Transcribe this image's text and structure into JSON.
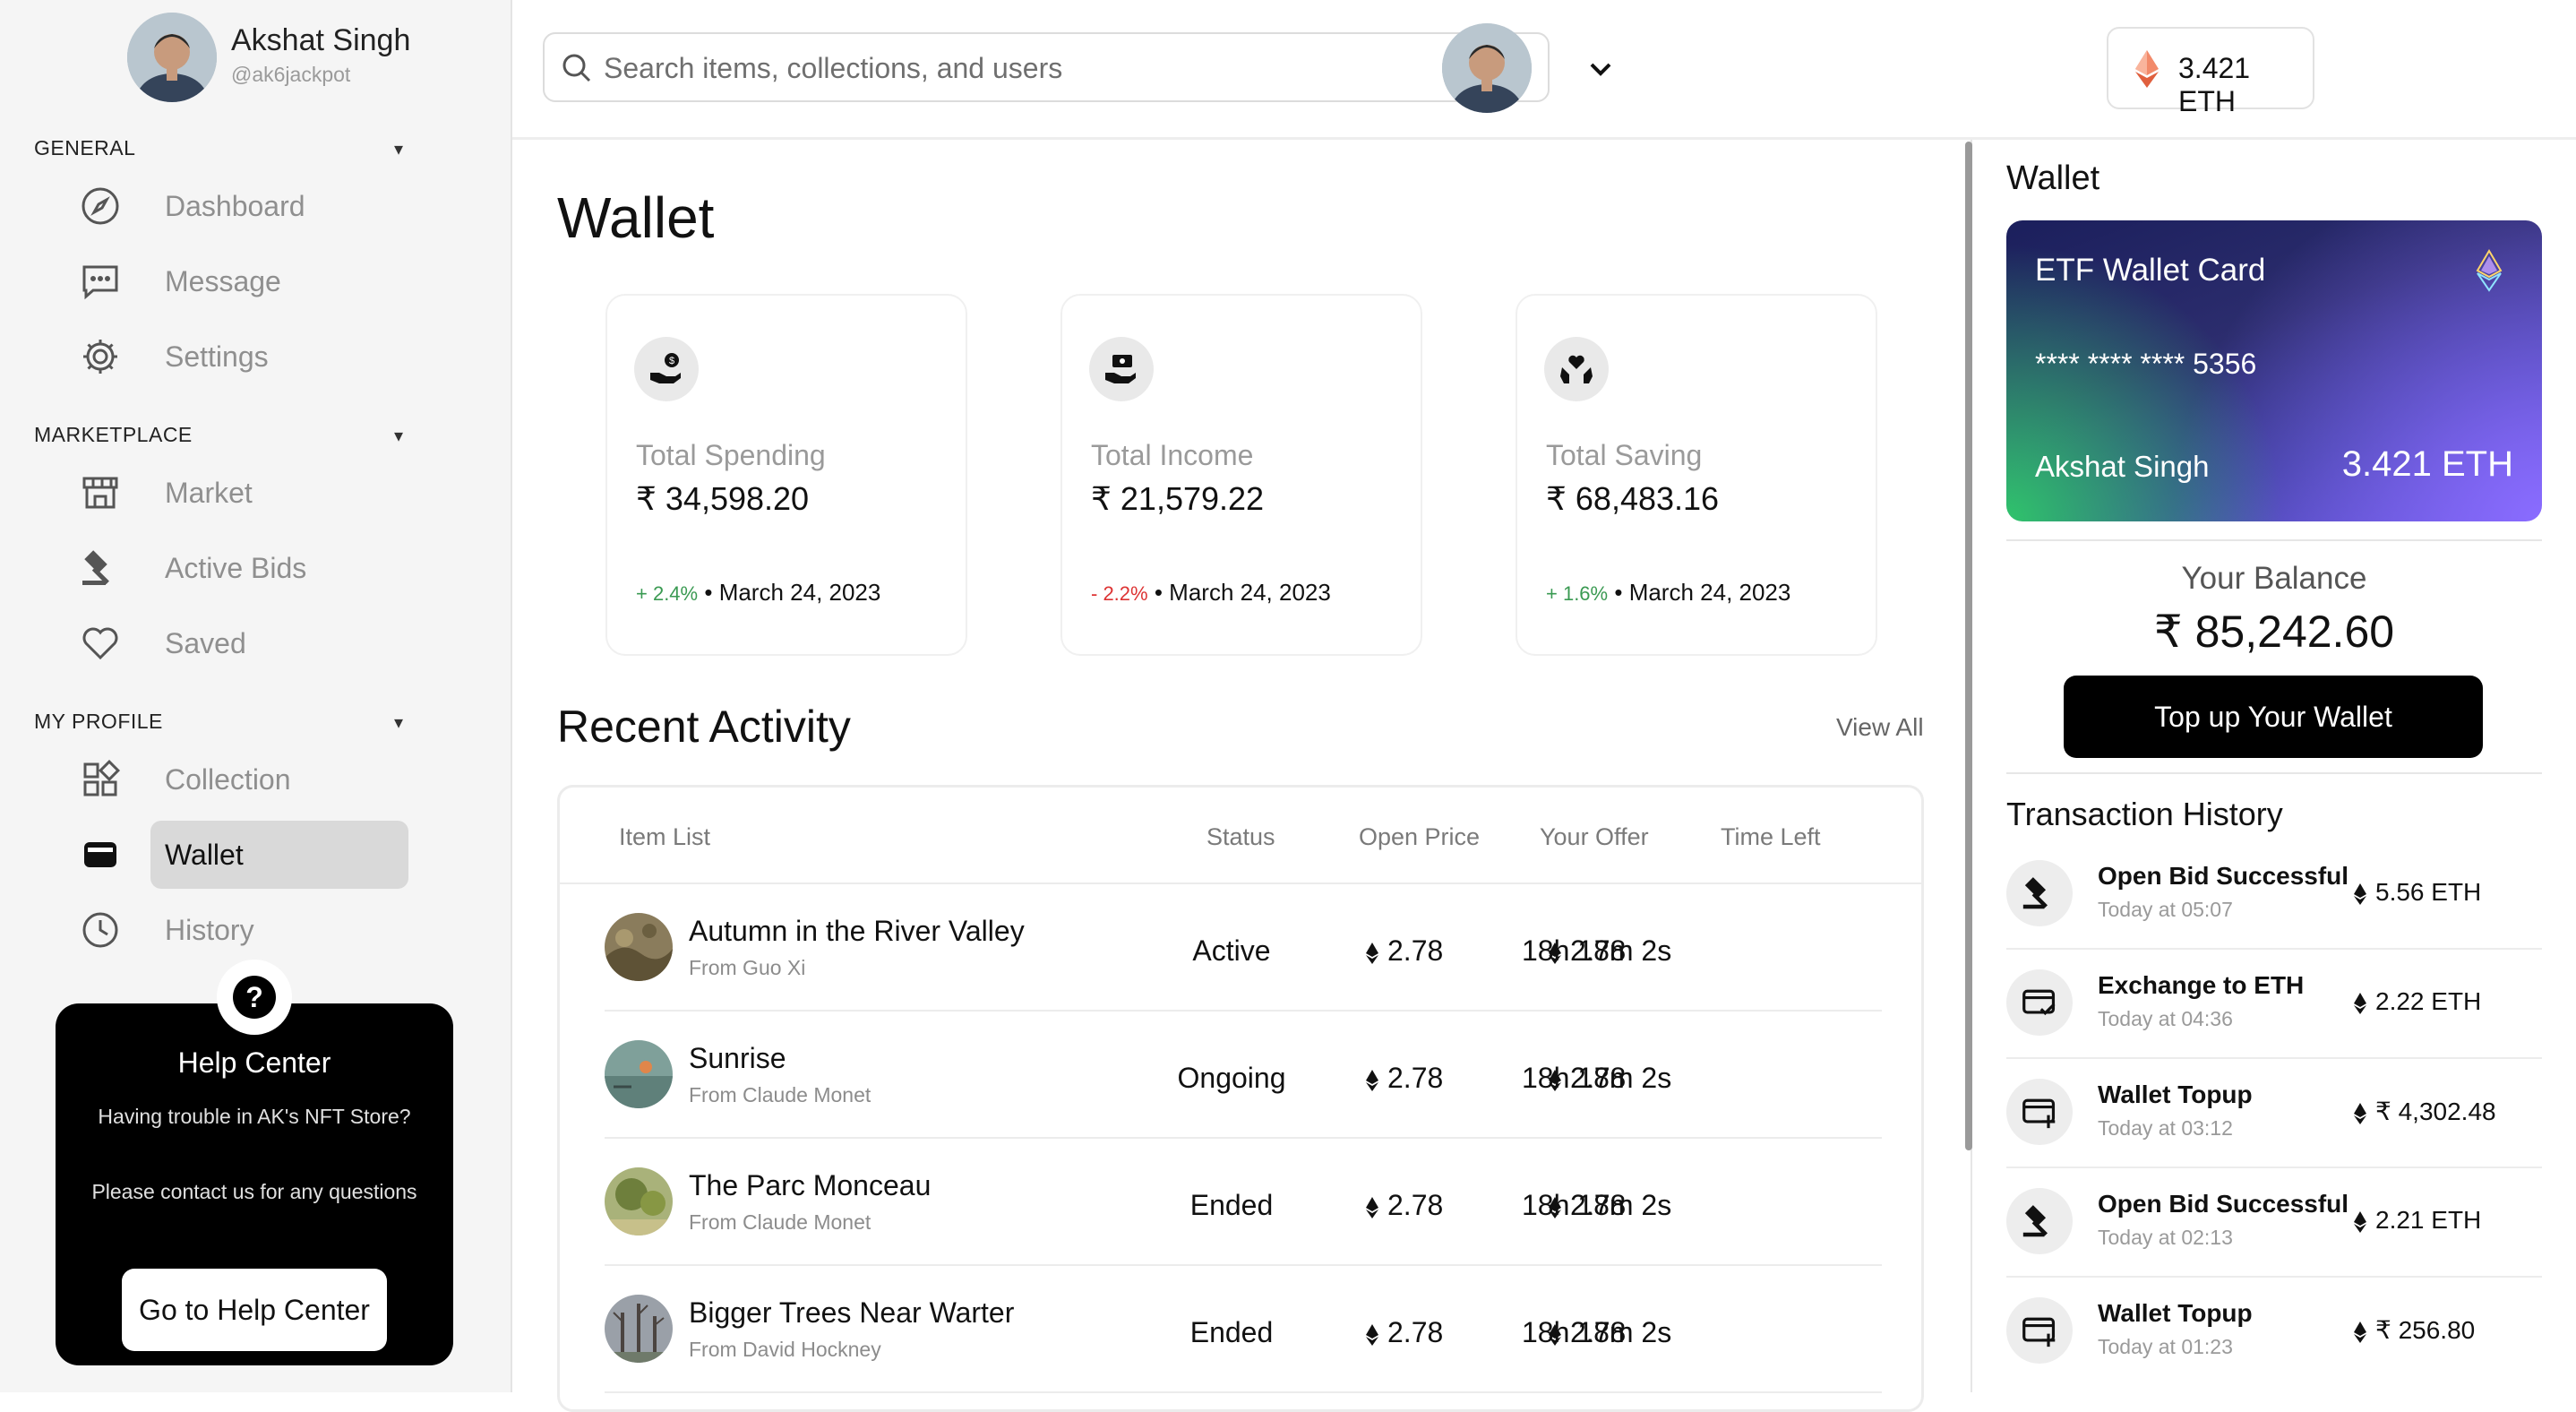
{
  "user": {
    "name": "Akshat Singh",
    "handle": "@ak6jackpot"
  },
  "sidebar": {
    "sections": [
      {
        "title": "GENERAL",
        "items": [
          {
            "label": "Dashboard",
            "icon": "compass-icon"
          },
          {
            "label": "Message",
            "icon": "message-icon"
          },
          {
            "label": "Settings",
            "icon": "gear-icon"
          }
        ]
      },
      {
        "title": "MARKETPLACE",
        "items": [
          {
            "label": "Market",
            "icon": "store-icon"
          },
          {
            "label": "Active Bids",
            "icon": "gavel-icon"
          },
          {
            "label": "Saved",
            "icon": "heart-icon"
          }
        ]
      },
      {
        "title": "MY PROFILE",
        "items": [
          {
            "label": "Collection",
            "icon": "grid-icon"
          },
          {
            "label": "Wallet",
            "icon": "wallet-icon",
            "active": true
          },
          {
            "label": "History",
            "icon": "clock-icon"
          }
        ]
      }
    ],
    "help": {
      "title": "Help Center",
      "text1": "Having trouble in AK's NFT Store?",
      "text2": "Please contact us for any questions",
      "button": "Go to Help Center"
    }
  },
  "header": {
    "search_placeholder": "Search items, collections, and users",
    "eth_balance": "3.421 ETH"
  },
  "main": {
    "title": "Wallet",
    "stats": [
      {
        "label": "Total Spending",
        "amount": "₹ 34,598.20",
        "change": "+ 2.4%",
        "trend": "up",
        "sep": "•",
        "date": "March 24, 2023"
      },
      {
        "label": "Total Income",
        "amount": "₹ 21,579.22",
        "change": "- 2.2%",
        "trend": "down",
        "sep": "•",
        "date": "March 24, 2023"
      },
      {
        "label": "Total Saving",
        "amount": "₹ 68,483.16",
        "change": "+ 1.6%",
        "trend": "up",
        "sep": "•",
        "date": "March 24, 2023"
      }
    ],
    "recent_title": "Recent Activity",
    "view_all": "View All",
    "table": {
      "headers": [
        "Item List",
        "Status",
        "Open Price",
        "Your Offer",
        "Time Left"
      ],
      "rows": [
        {
          "name": "Autumn in the River Valley",
          "by": "From Guo Xi",
          "status": "Active",
          "open": "2.78",
          "offer": "2.78",
          "time": "18h 18m 2s"
        },
        {
          "name": "Sunrise",
          "by": "From Claude Monet",
          "status": "Ongoing",
          "open": "2.78",
          "offer": "2.78",
          "time": "18h 18m 2s"
        },
        {
          "name": "The Parc Monceau",
          "by": "From Claude Monet",
          "status": "Ended",
          "open": "2.78",
          "offer": "2.78",
          "time": "18h 18m 2s"
        },
        {
          "name": "Bigger Trees Near Warter",
          "by": "From David Hockney",
          "status": "Ended",
          "open": "2.78",
          "offer": "2.78",
          "time": "18h 18m 2s"
        }
      ]
    }
  },
  "right": {
    "title": "Wallet",
    "card": {
      "name": "ETF Wallet Card",
      "number": "**** **** **** 5356",
      "holder": "Akshat Singh",
      "balance": "3.421 ETH"
    },
    "balance_label": "Your Balance",
    "balance": "₹ 85,242.60",
    "topup": "Top up Your Wallet",
    "history_title": "Transaction History",
    "transactions": [
      {
        "title": "Open Bid Successful",
        "time": "Today at 05:07",
        "amount": "5.56 ETH",
        "icon": "gavel-icon"
      },
      {
        "title": "Exchange to ETH",
        "time": "Today at 04:36",
        "amount": "2.22 ETH",
        "icon": "card-check-icon"
      },
      {
        "title": "Wallet Topup",
        "time": "Today at 03:12",
        "amount": "₹ 4,302.48",
        "icon": "card-plus-icon"
      },
      {
        "title": "Open Bid Successful",
        "time": "Today at 02:13",
        "amount": "2.21 ETH",
        "icon": "gavel-icon"
      },
      {
        "title": "Wallet Topup",
        "time": "Today at 01:23",
        "amount": "₹ 256.80",
        "icon": "card-plus-icon"
      }
    ]
  }
}
